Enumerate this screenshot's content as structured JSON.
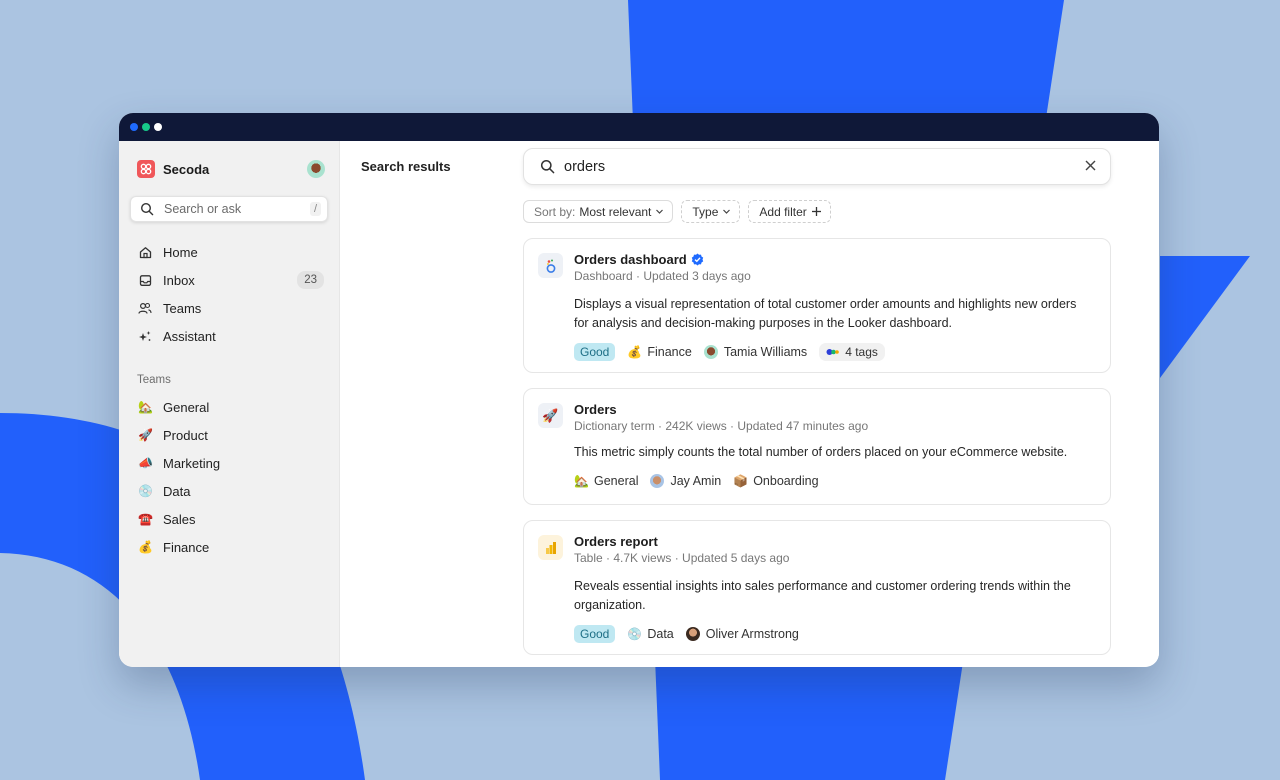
{
  "window": {
    "traffic_lights": [
      "blue",
      "green",
      "white"
    ]
  },
  "sidebar": {
    "workspace_name": "Secoda",
    "search_placeholder": "Search or ask",
    "search_shortcut": "/",
    "nav": [
      {
        "label": "Home",
        "icon": "home-icon"
      },
      {
        "label": "Inbox",
        "icon": "inbox-icon",
        "badge": "23"
      },
      {
        "label": "Teams",
        "icon": "users-icon"
      },
      {
        "label": "Assistant",
        "icon": "sparkle-icon"
      }
    ],
    "teams_heading": "Teams",
    "teams": [
      {
        "label": "General",
        "emoji": "🏡"
      },
      {
        "label": "Product",
        "emoji": "🚀"
      },
      {
        "label": "Marketing",
        "emoji": "📣"
      },
      {
        "label": "Data",
        "emoji": "💿"
      },
      {
        "label": "Sales",
        "emoji": "☎️"
      },
      {
        "label": "Finance",
        "emoji": "💰"
      }
    ]
  },
  "main": {
    "title": "Search results",
    "search_value": "orders",
    "filters": {
      "sort_prefix": "Sort by:",
      "sort_value": "Most relevant",
      "type_label": "Type",
      "add_filter_label": "Add filter"
    },
    "results": [
      {
        "title": "Orders dashboard",
        "verified": true,
        "icon": "looker-icon",
        "meta": "Dashboard · Updated 3 days ago",
        "description": "Displays a visual representation of total customer order amounts and highlights new orders for analysis and decision-making purposes in the Looker dashboard.",
        "status": "Good",
        "team": "Finance",
        "team_emoji": "💰",
        "owner": "Tamia Williams",
        "tags": "4 tags"
      },
      {
        "title": "Orders",
        "icon": "rocket-icon",
        "meta": "Dictionary term · 242K views · Updated 47 minutes ago",
        "description": "This metric simply counts the total number of orders placed on your eCommerce website.",
        "team": "General",
        "team_emoji": "🏡",
        "owner": "Jay Amin",
        "collection": "Onboarding",
        "collection_emoji": "📦"
      },
      {
        "title": "Orders report",
        "icon": "powerbi-icon",
        "meta": "Table · 4.7K views · Updated 5 days ago",
        "description": "Reveals essential insights into sales performance and customer ordering trends within the organization.",
        "status": "Good",
        "team": "Data",
        "team_emoji": "💿",
        "owner": "Oliver Armstrong"
      }
    ]
  }
}
